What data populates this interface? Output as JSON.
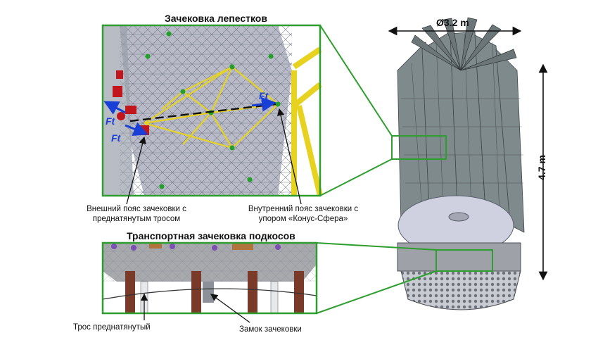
{
  "titles": {
    "top_panel": "Зачековка лепестков",
    "bottom_panel": "Транспортная зачековка подкосов"
  },
  "captions": {
    "outer_belt_line1": "Внешний пояс зачековки с",
    "outer_belt_line2": "преднатянутым тросом",
    "inner_belt_line1": "Внутренний пояс зачековки с",
    "inner_belt_line2": "упором «Конус-Сфера»",
    "cable": "Трос преднатянутый",
    "lock": "Замок зачековки"
  },
  "dimensions": {
    "diameter": "Ø3.2 m",
    "height": "4.7 m"
  },
  "force_labels": {
    "ft": "Ft"
  },
  "colors": {
    "frame_green": "#2e9e2e",
    "truss_yellow": "#e6d21f",
    "force_blue": "#1a3fd6",
    "lock_red": "#c0161c",
    "panel_grey": "#b7b9c6",
    "strut_brown": "#7a3a2a"
  }
}
